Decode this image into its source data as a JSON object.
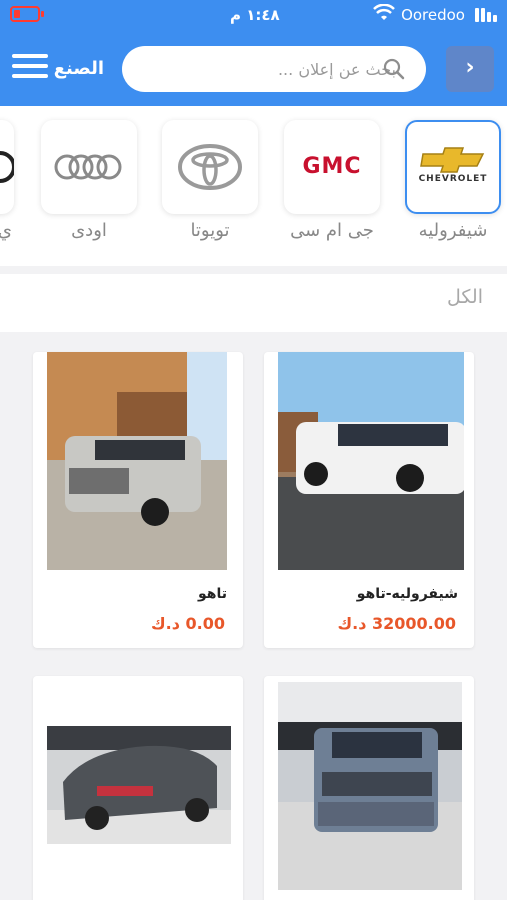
{
  "status_bar": {
    "time": "١:٤٨ م",
    "carrier": "Ooredoo"
  },
  "header": {
    "title": "الصنع",
    "search_placeholder": "بحث عن إعلان ...",
    "back_icon": "chevron-right-icon",
    "menu_icon": "hamburger-icon",
    "accent_color": "#3d8ef0"
  },
  "brands": [
    {
      "name": "شيفروليه",
      "logo_text": "CHEVROLET",
      "selected": true
    },
    {
      "name": "جى ام سى",
      "logo_text": "GMC",
      "selected": false
    },
    {
      "name": "تويوتا",
      "logo_text": "",
      "selected": false
    },
    {
      "name": "اودى",
      "logo_text": "",
      "selected": false
    },
    {
      "name": "ي",
      "logo_text": "",
      "selected": false
    }
  ],
  "filter": {
    "all_label": "الكل"
  },
  "listings": [
    {
      "title": "شيفروليه-تاهو",
      "price": "32000.00 د.ك"
    },
    {
      "title": "تاهو",
      "price": "0.00 د.ك"
    },
    {
      "title": "",
      "price": ""
    },
    {
      "title": "",
      "price": ""
    }
  ]
}
